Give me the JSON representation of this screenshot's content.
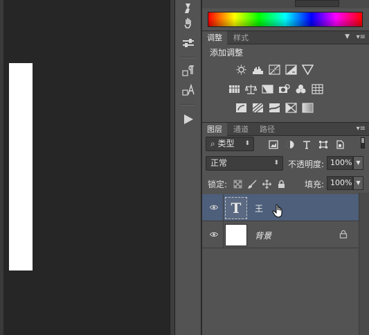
{
  "toolstrip": {
    "items": [
      {
        "name": "brush-tool-icon"
      },
      {
        "name": "sliders-icon"
      },
      {
        "name": "paragraph-icon"
      },
      {
        "name": "character-icon"
      },
      {
        "name": "play-action-icon"
      }
    ]
  },
  "adjustments": {
    "tabs": [
      {
        "label": "调整",
        "active": true
      },
      {
        "label": "样式",
        "active": false
      }
    ],
    "title": "添加调整",
    "rows": [
      [
        "brightness-icon",
        "levels-icon",
        "curves-icon",
        "exposure-icon",
        "vibrance-triangle-icon"
      ],
      [
        "hue-saturation-icon",
        "color-balance-icon",
        "black-white-icon",
        "photo-filter-icon",
        "channel-mixer-icon",
        "color-lookup-icon"
      ],
      [
        "invert-icon",
        "posterize-icon",
        "threshold-icon",
        "selective-color-icon",
        "gradient-map-icon"
      ]
    ]
  },
  "layers": {
    "tabs": [
      {
        "label": "图层",
        "active": true
      },
      {
        "label": "通道",
        "active": false
      },
      {
        "label": "路径",
        "active": false
      }
    ],
    "filter": {
      "kind": "类型"
    },
    "blend_mode": "正常",
    "opacity_label": "不透明度:",
    "opacity_value": "100%",
    "lock_label": "锁定:",
    "fill_label": "填充:",
    "fill_value": "100%",
    "items": [
      {
        "name": "王",
        "type": "text",
        "thumb_glyph": "T",
        "selected": true,
        "visible": true,
        "locked": false
      },
      {
        "name": "背景",
        "type": "background",
        "selected": false,
        "visible": true,
        "locked": true
      }
    ]
  },
  "colors": {
    "selected_layer": "#4d5f7b",
    "panel_bg": "#535353",
    "canvas_bg": "#262626"
  }
}
